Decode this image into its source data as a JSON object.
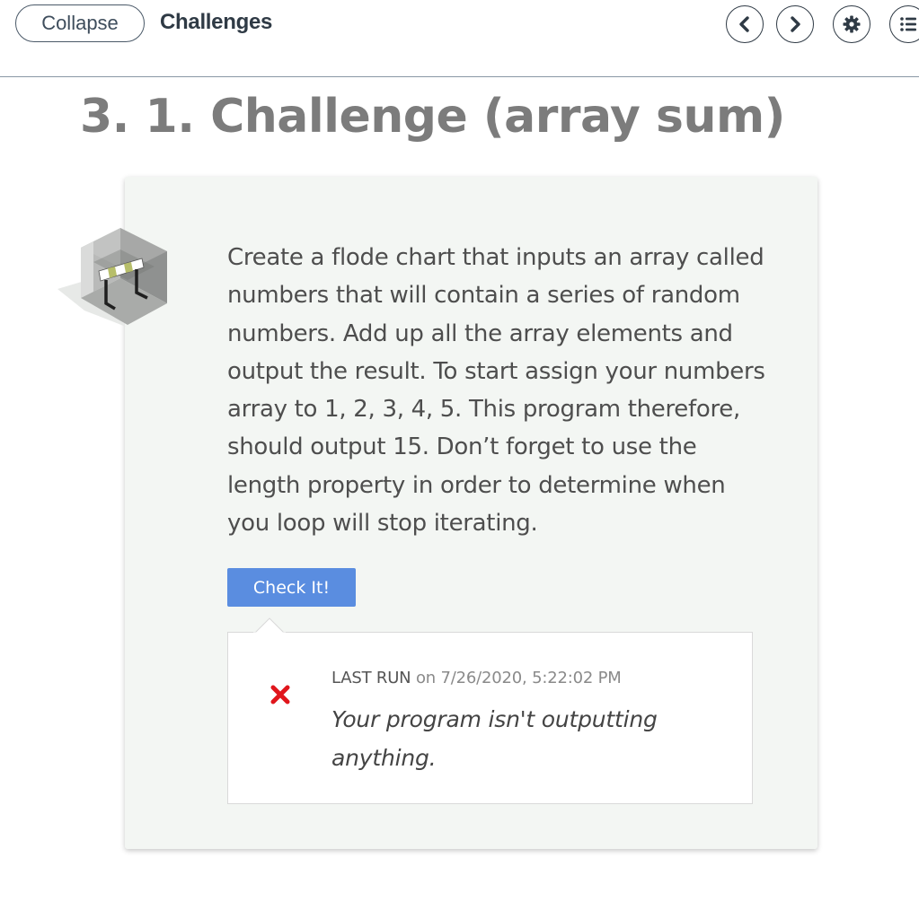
{
  "header": {
    "collapse_label": "Collapse",
    "section_title": "Challenges",
    "nav": [
      {
        "icon": "chevron-left-icon"
      },
      {
        "icon": "chevron-right-icon"
      },
      {
        "icon": "gear-icon"
      },
      {
        "icon": "list-icon"
      }
    ]
  },
  "page": {
    "heading": "3. 1. Challenge (array sum)"
  },
  "challenge": {
    "icon": "hurdle-cube-icon",
    "description": "Create a flode chart that inputs an array called numbers that will contain a series of random numbers. Add up all the array elements and output the result. To start assign your numbers array to 1, 2, 3, 4, 5. This program therefore, should output 15. Don’t forget to use the length property in order to determine when you loop will stop iterating.",
    "check_label": "Check It!"
  },
  "result": {
    "status_icon": "close-icon",
    "status_color": "#e0161c",
    "last_run_label": "LAST RUN",
    "on_text": "on",
    "timestamp": "7/26/2020, 5:22:02 PM",
    "message": "Your program isn't outputting anything."
  },
  "colors": {
    "accent": "#5a8de0",
    "card_background": "#f3f6f3",
    "heading": "#7c7c7c"
  }
}
